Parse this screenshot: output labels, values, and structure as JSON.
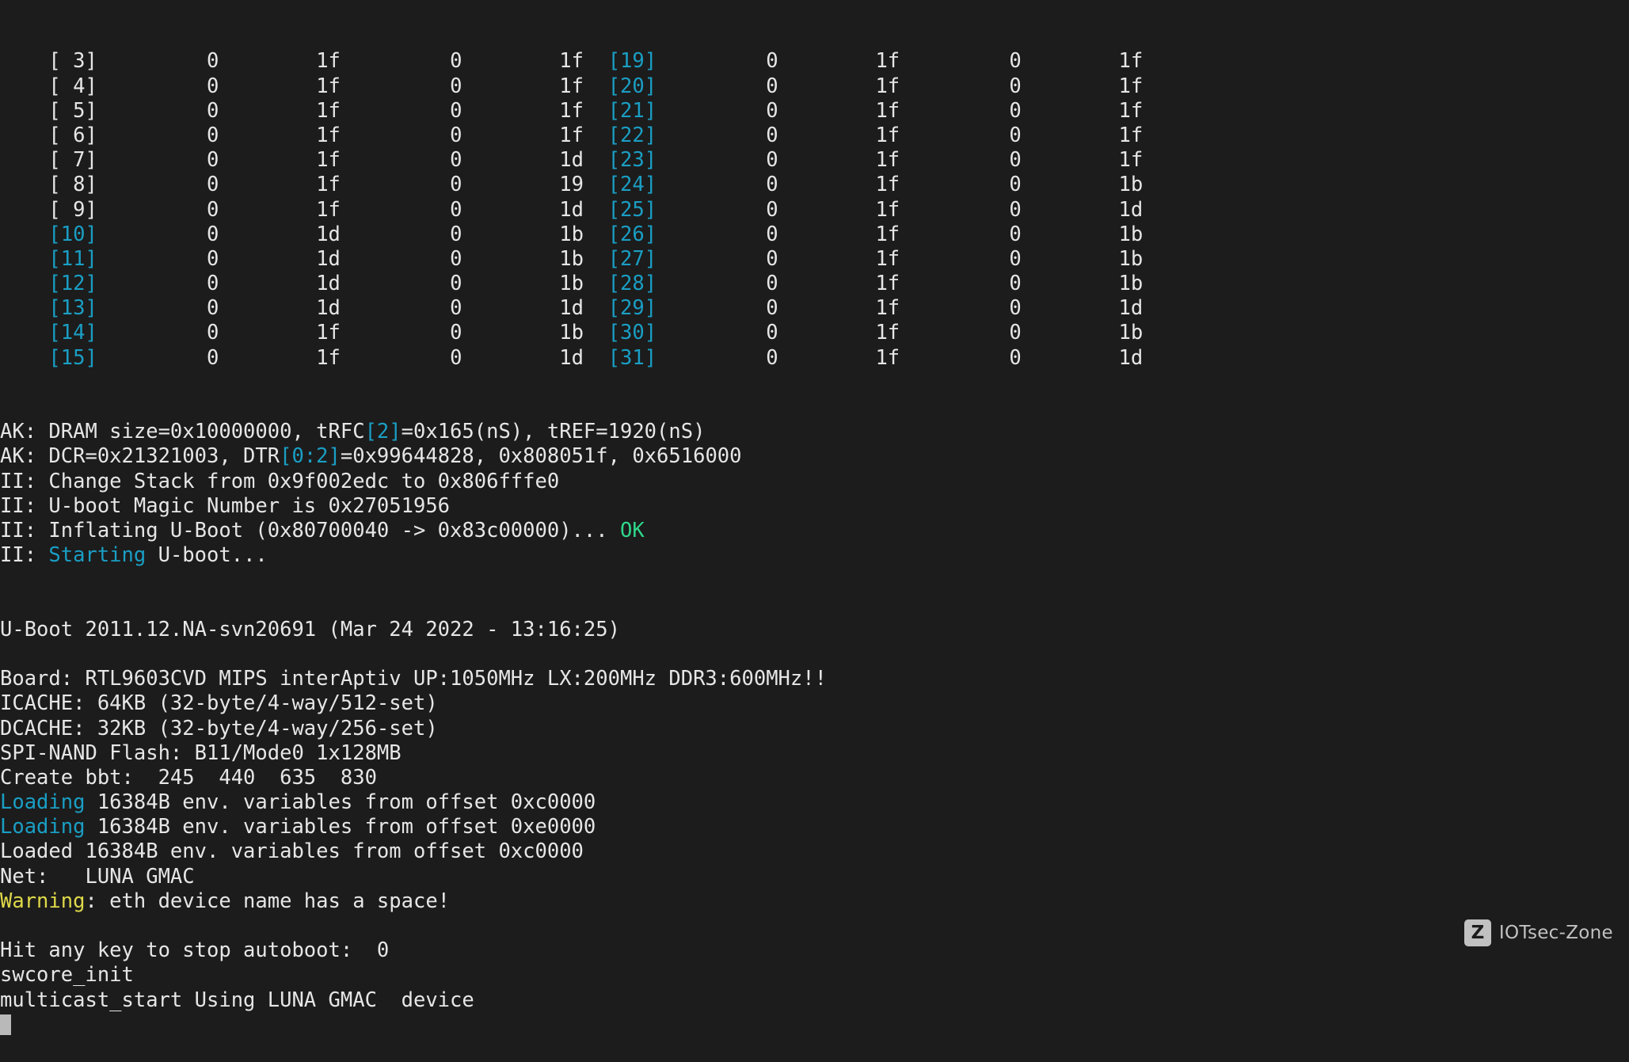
{
  "terminal": {
    "background_color": "#1c1c1c",
    "foreground_color": "#e6e6e6",
    "cyan_color": "#1a9ec4",
    "green_color": "#2fd68a",
    "yellow_color": "#dfd94a",
    "cursor_char": "█"
  },
  "table": {
    "left_rows": [
      {
        "index": "[ 3]",
        "index_color": "white",
        "c1": "0",
        "c2": "1f",
        "c3": "0",
        "c4": "1f"
      },
      {
        "index": "[ 4]",
        "index_color": "white",
        "c1": "0",
        "c2": "1f",
        "c3": "0",
        "c4": "1f"
      },
      {
        "index": "[ 5]",
        "index_color": "white",
        "c1": "0",
        "c2": "1f",
        "c3": "0",
        "c4": "1f"
      },
      {
        "index": "[ 6]",
        "index_color": "white",
        "c1": "0",
        "c2": "1f",
        "c3": "0",
        "c4": "1f"
      },
      {
        "index": "[ 7]",
        "index_color": "white",
        "c1": "0",
        "c2": "1f",
        "c3": "0",
        "c4": "1d"
      },
      {
        "index": "[ 8]",
        "index_color": "white",
        "c1": "0",
        "c2": "1f",
        "c3": "0",
        "c4": "19"
      },
      {
        "index": "[ 9]",
        "index_color": "white",
        "c1": "0",
        "c2": "1f",
        "c3": "0",
        "c4": "1d"
      },
      {
        "index": "[10]",
        "index_color": "cyan",
        "c1": "0",
        "c2": "1d",
        "c3": "0",
        "c4": "1b"
      },
      {
        "index": "[11]",
        "index_color": "cyan",
        "c1": "0",
        "c2": "1d",
        "c3": "0",
        "c4": "1b"
      },
      {
        "index": "[12]",
        "index_color": "cyan",
        "c1": "0",
        "c2": "1d",
        "c3": "0",
        "c4": "1b"
      },
      {
        "index": "[13]",
        "index_color": "cyan",
        "c1": "0",
        "c2": "1d",
        "c3": "0",
        "c4": "1d"
      },
      {
        "index": "[14]",
        "index_color": "cyan",
        "c1": "0",
        "c2": "1f",
        "c3": "0",
        "c4": "1b"
      },
      {
        "index": "[15]",
        "index_color": "cyan",
        "c1": "0",
        "c2": "1f",
        "c3": "0",
        "c4": "1d"
      }
    ],
    "right_rows": [
      {
        "index": "[19]",
        "index_color": "cyan",
        "c1": "0",
        "c2": "1f",
        "c3": "0",
        "c4": "1f"
      },
      {
        "index": "[20]",
        "index_color": "cyan",
        "c1": "0",
        "c2": "1f",
        "c3": "0",
        "c4": "1f"
      },
      {
        "index": "[21]",
        "index_color": "cyan",
        "c1": "0",
        "c2": "1f",
        "c3": "0",
        "c4": "1f"
      },
      {
        "index": "[22]",
        "index_color": "cyan",
        "c1": "0",
        "c2": "1f",
        "c3": "0",
        "c4": "1f"
      },
      {
        "index": "[23]",
        "index_color": "cyan",
        "c1": "0",
        "c2": "1f",
        "c3": "0",
        "c4": "1f"
      },
      {
        "index": "[24]",
        "index_color": "cyan",
        "c1": "0",
        "c2": "1f",
        "c3": "0",
        "c4": "1b"
      },
      {
        "index": "[25]",
        "index_color": "cyan",
        "c1": "0",
        "c2": "1f",
        "c3": "0",
        "c4": "1d"
      },
      {
        "index": "[26]",
        "index_color": "cyan",
        "c1": "0",
        "c2": "1f",
        "c3": "0",
        "c4": "1b"
      },
      {
        "index": "[27]",
        "index_color": "cyan",
        "c1": "0",
        "c2": "1f",
        "c3": "0",
        "c4": "1b"
      },
      {
        "index": "[28]",
        "index_color": "cyan",
        "c1": "0",
        "c2": "1f",
        "c3": "0",
        "c4": "1b"
      },
      {
        "index": "[29]",
        "index_color": "cyan",
        "c1": "0",
        "c2": "1f",
        "c3": "0",
        "c4": "1d"
      },
      {
        "index": "[30]",
        "index_color": "cyan",
        "c1": "0",
        "c2": "1f",
        "c3": "0",
        "c4": "1b"
      },
      {
        "index": "[31]",
        "index_color": "cyan",
        "c1": "0",
        "c2": "1f",
        "c3": "0",
        "c4": "1d"
      }
    ]
  },
  "log": {
    "dram_line": {
      "p1": "AK: DRAM size=0x10000000, tRFC",
      "p2": "[2]",
      "p3": "=0x165(nS), tREF=1920(nS)"
    },
    "dcr_line": {
      "p1": "AK: DCR=0x21321003, DTR",
      "p2": "[0:2]",
      "p3": "=0x99644828, 0x808051f, 0x6516000"
    },
    "change_stack": "II: Change Stack from 0x9f002edc to 0x806fffe0",
    "magic_number": "II: U-boot Magic Number is 0x27051956",
    "inflating": {
      "p1": "II: Inflating U-Boot (0x80700040 -> 0x83c00000)... ",
      "ok": "OK"
    },
    "starting": {
      "p1": "II: ",
      "word": "Starting",
      "p2": " U-boot..."
    },
    "uboot_version": "U-Boot 2011.12.NA-svn20691 (Mar 24 2022 - 13:16:25)",
    "board": "Board: RTL9603CVD MIPS interAptiv UP:1050MHz LX:200MHz DDR3:600MHz!!",
    "icache": "ICACHE: 64KB (32-byte/4-way/512-set)",
    "dcache": "DCACHE: 32KB (32-byte/4-way/256-set)",
    "spi_nand": "SPI-NAND Flash: B11/Mode0 1x128MB",
    "create_bbt": "Create bbt:  245  440  635  830",
    "loading1": {
      "word": "Loading",
      "rest": " 16384B env. variables from offset 0xc0000"
    },
    "loading2": {
      "word": "Loading",
      "rest": " 16384B env. variables from offset 0xe0000"
    },
    "loaded": "Loaded 16384B env. variables from offset 0xc0000",
    "net": "Net:   LUNA GMAC",
    "warning": {
      "word": "Warning",
      "rest": ": eth device name has a space!"
    },
    "autoboot": "Hit any key to stop autoboot:  0",
    "swcore_init": "swcore_init",
    "multicast_start": "multicast_start Using LUNA GMAC  device"
  },
  "watermark": {
    "logo_letter": "Z",
    "text": "IOTsec-Zone"
  }
}
